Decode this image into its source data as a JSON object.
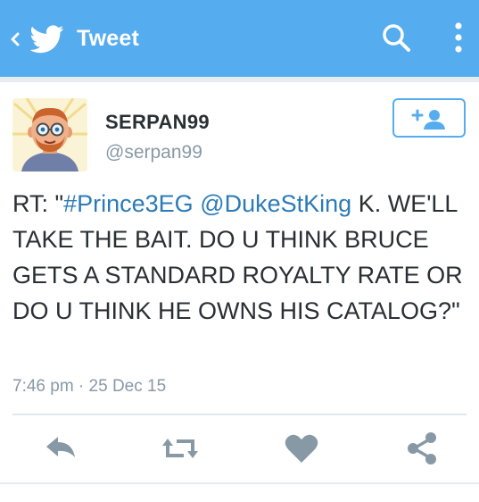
{
  "appbar": {
    "title": "Tweet",
    "back_icon": "chevron-left-icon",
    "logo_icon": "twitter-bird-icon",
    "search_icon": "search-icon",
    "more_icon": "more-vertical-icon",
    "background_color": "#55acee"
  },
  "tweet": {
    "display_name": "SERPAN99",
    "handle": "@serpan99",
    "text": {
      "prefix": "RT: \"",
      "hashtag": "#Prince3EG",
      "space": " ",
      "mention": "@DukeStKing",
      "body": " K. WE'LL TAKE THE BAIT. DO U THINK BRUCE GETS A STANDARD ROYALTY RATE OR DO U THINK HE OWNS HIS CATALOG?\""
    },
    "timestamp": "7:46 pm · 25 Dec 15",
    "follow_icon": "follow-user-icon",
    "link_color": "#2b7bb9"
  },
  "actions": [
    {
      "name": "reply-button",
      "icon": "reply-icon"
    },
    {
      "name": "retweet-button",
      "icon": "retweet-icon"
    },
    {
      "name": "like-button",
      "icon": "heart-icon"
    },
    {
      "name": "share-button",
      "icon": "share-icon"
    }
  ]
}
